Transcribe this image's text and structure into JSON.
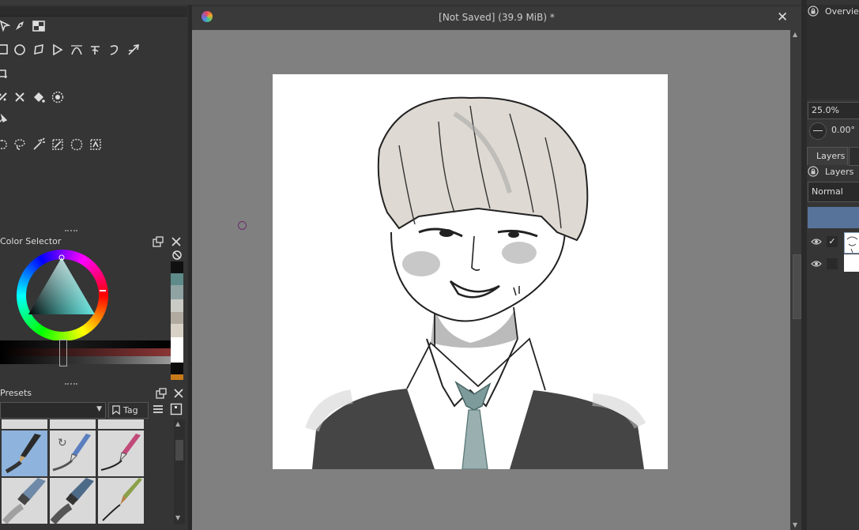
{
  "window": {
    "title": "[Not Saved]  (39.9 MiB) *",
    "close_label": "✕"
  },
  "color_selector": {
    "title": "Color Selector",
    "swatches": [
      "#101010",
      "#5e8a8a",
      "#8fa3a3",
      "#cbcbc5",
      "#b0aaa0",
      "#d8d2c6",
      "#ffffff",
      "#0c0c0c",
      "#c87a1a"
    ]
  },
  "presets": {
    "title": "Presets",
    "tag_label": "Tag",
    "combo_value": ""
  },
  "right_dock": {
    "overview_label": "Overview",
    "zoom_value": "25.0%",
    "rotation_value": "0.00°",
    "layers_tab": "Layers",
    "layers_title": "Layers",
    "blend_mode": "Normal"
  },
  "icons": {
    "tools_row1": [
      "select-shapes-icon",
      "edit-shapes-icon",
      "calligraphy-icon"
    ],
    "tools_row2": [
      "rectangle-icon",
      "ellipse-icon",
      "polygon-icon",
      "polyline-icon",
      "bezier-icon",
      "freehand-path-icon",
      "dynamic-brush-icon",
      "multibrush-icon"
    ],
    "tools_row3": [
      "crop-icon"
    ],
    "tools_row4": [
      "colorize-icon",
      "smart-patch-icon",
      "fill-icon",
      "gradient-icon"
    ],
    "tools_row5": [
      "measure-icon"
    ],
    "tools_row6": [
      "elliptical-select-icon",
      "lasso-select-icon",
      "magic-wand-icon",
      "similar-select-icon",
      "bezier-select-icon",
      "magnetic-select-icon"
    ]
  }
}
